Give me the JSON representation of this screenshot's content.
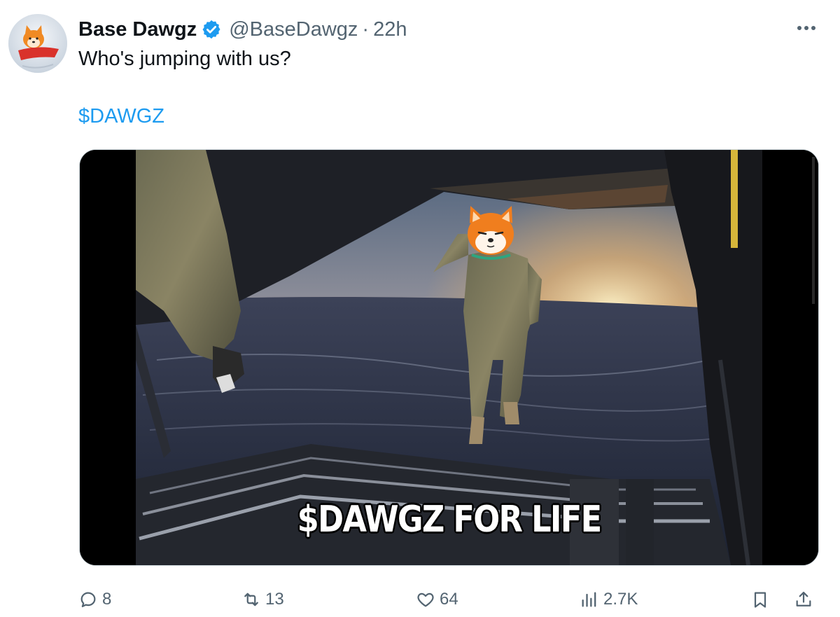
{
  "tweet": {
    "author_name": "Base Dawgz",
    "handle": "@BaseDawgz",
    "separator": "·",
    "time": "22h",
    "text": "Who's jumping with us?",
    "cashtag": "$DAWGZ",
    "media_caption": "$DAWGZ FOR LIFE",
    "more_icon": "more-horizontal-icon"
  },
  "actions": {
    "replies": "8",
    "reposts": "13",
    "likes": "64",
    "views": "2.7K",
    "icons": [
      "reply-icon",
      "repost-icon",
      "like-icon",
      "views-icon",
      "bookmark-icon",
      "share-icon"
    ]
  },
  "colors": {
    "accent": "#1d9bf0",
    "text_primary": "#0f1419",
    "text_secondary": "#536471"
  }
}
